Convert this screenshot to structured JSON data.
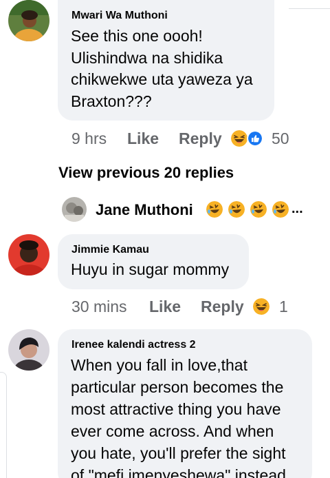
{
  "comment1": {
    "author": "Mwari Wa Muthoni",
    "lines": [
      "See this one oooh!",
      "Ulishindwa na shidika",
      "chikwekwe uta yaweza ya",
      "Braxton???"
    ],
    "time": "9 hrs",
    "like_label": "Like",
    "reply_label": "Reply",
    "reaction_count": "50",
    "reaction_icons": [
      "laughing-emoji-icon",
      "like-thumb-icon"
    ]
  },
  "view_previous": "View previous 20 replies",
  "reply_preview": {
    "author": "Jane Muthoni",
    "reaction_icons": [
      "rolling-laughing-emoji-icon",
      "rolling-laughing-emoji-icon",
      "rolling-laughing-emoji-icon",
      "rolling-laughing-emoji-icon"
    ],
    "ellipsis": "..."
  },
  "comment2": {
    "author": "Jimmie Kamau",
    "lines": [
      "Huyu in sugar mommy"
    ],
    "time": "30 mins",
    "like_label": "Like",
    "reply_label": "Reply",
    "reaction_count": "1",
    "reaction_icons": [
      "laughing-emoji-icon"
    ]
  },
  "comment3": {
    "author": "Irenee kalendi actress 2",
    "lines": [
      "When you fall in love,that",
      "particular person becomes the",
      "most attractive thing you have",
      "ever come across. And when",
      "you hate, you'll prefer the sight",
      "of \"mefi imenyeshewa\" instead"
    ]
  },
  "colors": {
    "bubble": "#f0f2f5",
    "meta_gray": "#65676b",
    "like_blue": "#1877f2",
    "emoji_yellow": "#f7b125"
  }
}
